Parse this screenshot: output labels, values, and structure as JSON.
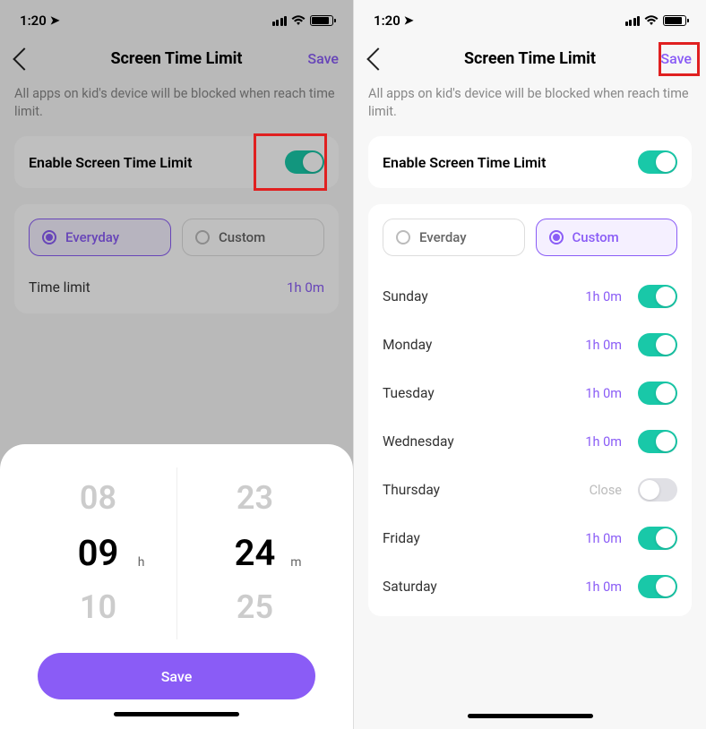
{
  "colors": {
    "accent": "#8a5cf6",
    "toggle_on": "#19c8a8",
    "redbox": "#e02020"
  },
  "status": {
    "time": "1:20"
  },
  "nav": {
    "title": "Screen Time Limit",
    "save_label": "Save"
  },
  "desc_text": "All apps on kid's device will be blocked when reach time limit.",
  "enable": {
    "label": "Enable Screen Time Limit"
  },
  "mode_tabs": {
    "left": {
      "everyday": "Everyday",
      "custom": "Custom"
    },
    "right": {
      "everyday": "Everday",
      "custom": "Custom"
    }
  },
  "time_limit_row": {
    "label": "Time limit",
    "value": "1h 0m"
  },
  "days": [
    {
      "name": "Sunday",
      "value": "1h 0m",
      "on": true
    },
    {
      "name": "Monday",
      "value": "1h 0m",
      "on": true
    },
    {
      "name": "Tuesday",
      "value": "1h 0m",
      "on": true
    },
    {
      "name": "Wednesday",
      "value": "1h 0m",
      "on": true
    },
    {
      "name": "Thursday",
      "value": "Close",
      "on": false
    },
    {
      "name": "Friday",
      "value": "1h 0m",
      "on": true
    },
    {
      "name": "Saturday",
      "value": "1h 0m",
      "on": true
    }
  ],
  "picker": {
    "hours": {
      "prev": "08",
      "current": "09",
      "next": "10",
      "unit": "h"
    },
    "minutes": {
      "prev": "23",
      "current": "24",
      "next": "25",
      "unit": "m"
    },
    "save_label": "Save"
  }
}
